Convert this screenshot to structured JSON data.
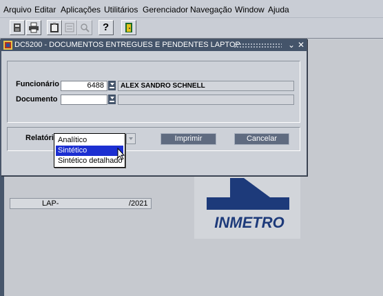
{
  "menu": [
    "Arquivo",
    "Editar",
    "Aplicações",
    "Utilitários",
    "Gerenciador",
    "Navegação",
    "Window",
    "Ajuda"
  ],
  "toolbar": {
    "icons": [
      "save-icon",
      "print-icon",
      "clipboard-icon",
      "edit-form-icon",
      "magnifier-icon",
      "help-icon",
      "exit-door-icon"
    ],
    "help_glyph": "?"
  },
  "dialog": {
    "title": "DC5200 - DOCUMENTOS ENTREGUES E PENDENTES LAPTOP",
    "controls": {
      "restore": "⌄",
      "close": "✕"
    },
    "funcionario": {
      "label": "Funcionário",
      "value": "6488",
      "name": "ALEX SANDRO SCHNELL"
    },
    "documento": {
      "label": "Documento",
      "value": "",
      "name": ""
    },
    "relatorio": {
      "label": "Relatório",
      "options": [
        "Analítico",
        "Sintético",
        "Sintético detalhado"
      ],
      "selected": "Sintético"
    },
    "buttons": {
      "print": "Imprimir",
      "cancel": "Cancelar"
    },
    "status": {
      "left": "LAP-",
      "right": "/2021"
    }
  },
  "logo": {
    "text": "INMETRO",
    "color": "#1d3a7a"
  }
}
